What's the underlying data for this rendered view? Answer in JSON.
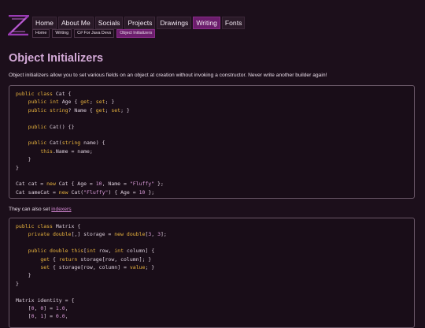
{
  "nav": {
    "items": [
      "Home",
      "About Me",
      "Socials",
      "Projects",
      "Drawings",
      "Writing",
      "Fonts"
    ],
    "active": "Writing"
  },
  "breadcrumb": [
    "Home",
    "Writing",
    "C# For Java Devs",
    "Object Initializers"
  ],
  "page": {
    "title": "Object Initializers",
    "intro": "Object initializers allow you to set various fields on an object at creation without invoking a constructor. Never write another builder again!",
    "mid_text": "They can also set ",
    "mid_link": "indexers"
  },
  "code1": [
    "public class Cat {",
    "    public int Age { get; set; }",
    "    public string? Name { get; set; }",
    "",
    "    public Cat() {}",
    "",
    "    public Cat(string name) {",
    "        this.Name = name;",
    "    }",
    "}",
    "",
    "Cat cat = new Cat { Age = 10, Name = \"Fluffy\" };",
    "Cat sameCat = new Cat(\"Fluffy\") { Age = 10 };"
  ],
  "code2": [
    "public class Matrix {",
    "    private double[,] storage = new double[3, 3];",
    "",
    "    public double this[int row, int column] {",
    "        get { return storage[row, column]; }",
    "        set { storage[row, column] = value; }",
    "    }",
    "}",
    "",
    "Matrix identity = {",
    "    [0, 0] = 1.0,",
    "    [0, 1] = 0.0,"
  ],
  "colors": {
    "background": "#1c0f1b",
    "accent": "#6b1d6c",
    "heading": "#d4aad8",
    "keyword": "#e8b33d",
    "literal": "#d99bd9",
    "link": "#d48ad4"
  },
  "icons": {
    "logo": "site-logo-icon"
  }
}
